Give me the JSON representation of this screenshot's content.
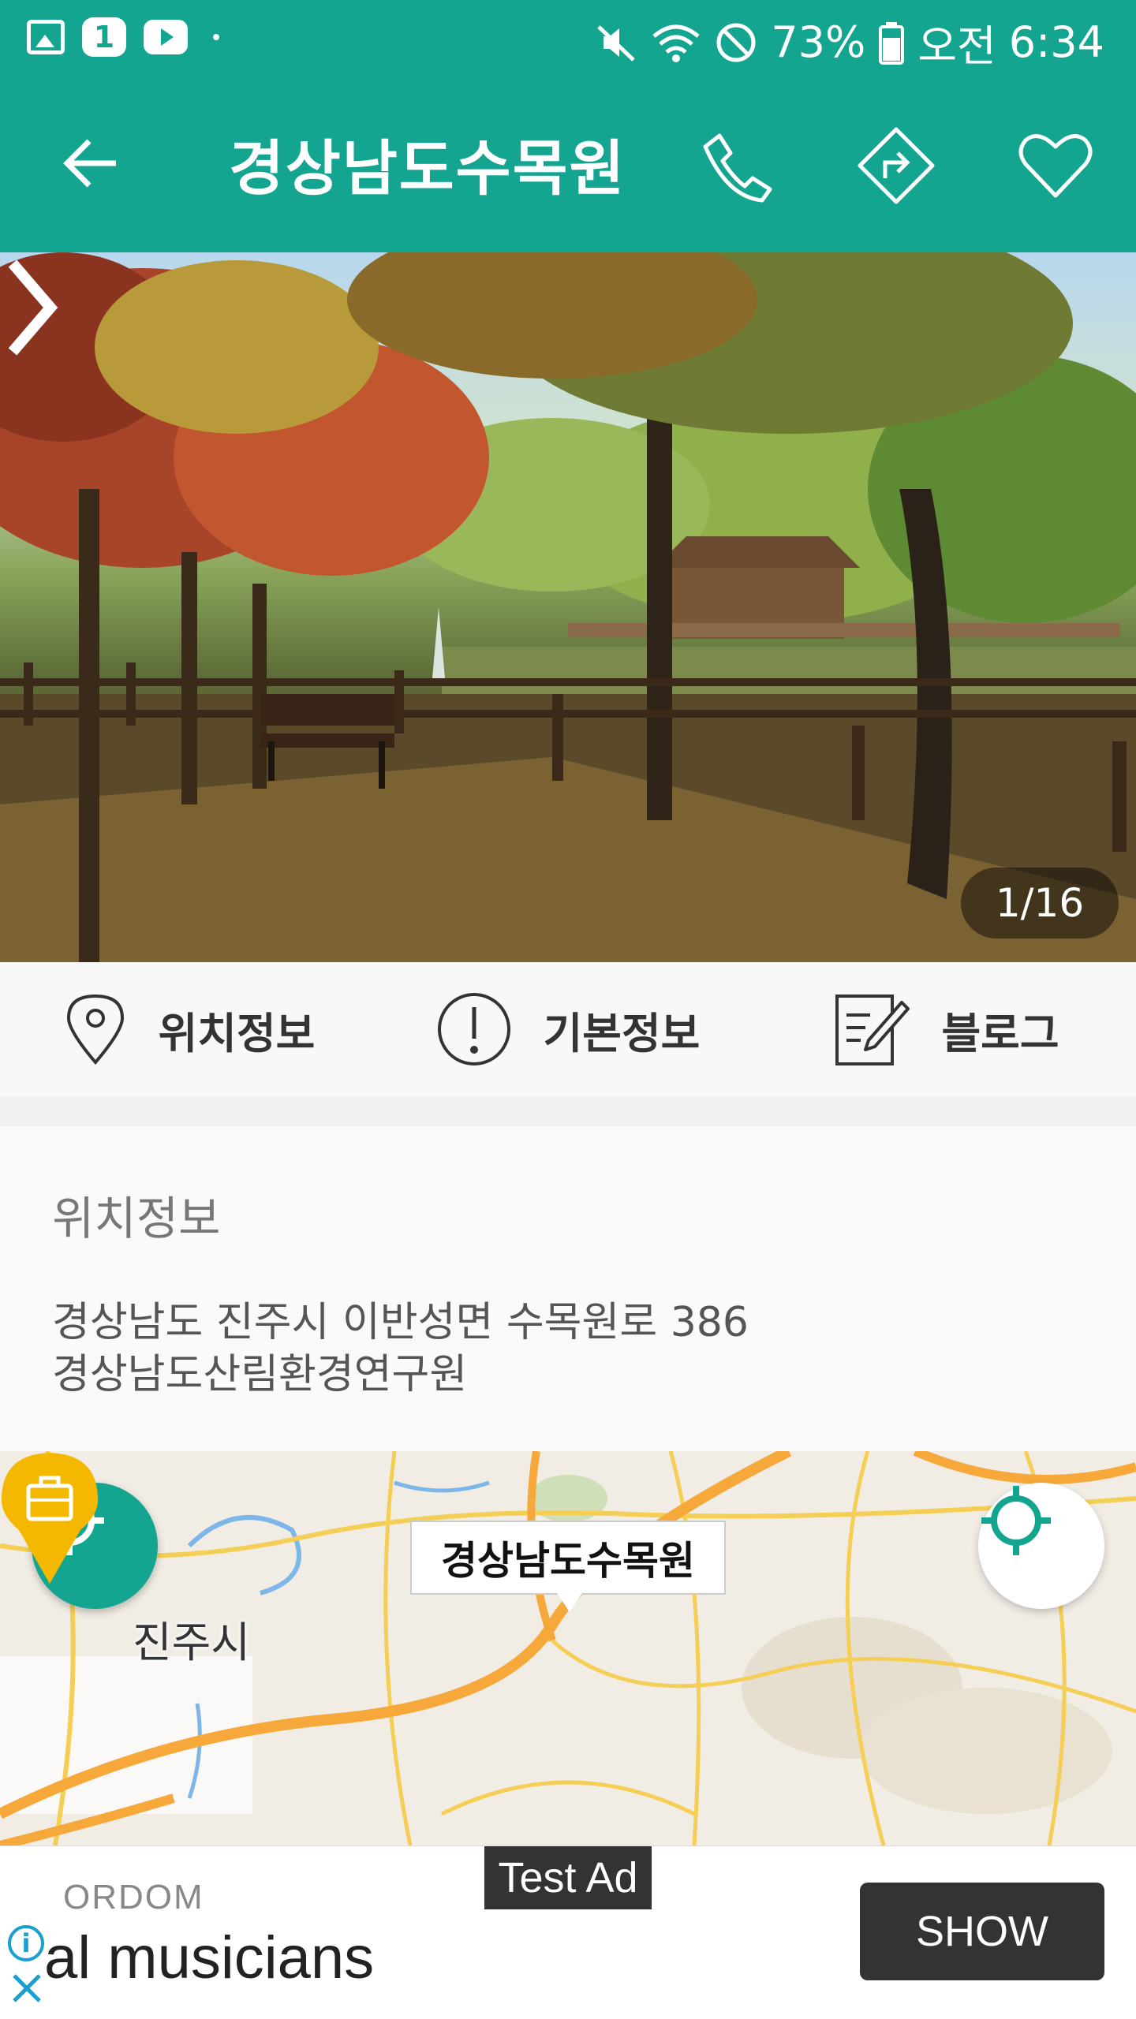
{
  "status_bar": {
    "battery": "73%",
    "ampm": "오전",
    "time": "6:34",
    "notification_badge": "1",
    "icons": [
      "image-icon",
      "one-badge-icon",
      "youtube-icon",
      "mute-icon",
      "wifi-icon",
      "block-icon",
      "battery-icon"
    ]
  },
  "app_bar": {
    "title": "경상남도수목원",
    "icons": [
      "back-arrow-icon",
      "phone-icon",
      "directions-icon",
      "heart-icon"
    ]
  },
  "photo": {
    "counter": "1/16"
  },
  "tabs": [
    {
      "label": "위치정보",
      "icon": "location-pin-icon"
    },
    {
      "label": "기본정보",
      "icon": "info-alert-icon"
    },
    {
      "label": "블로그",
      "icon": "blog-edit-icon"
    }
  ],
  "location": {
    "title": "위치정보",
    "address_line1": "경상남도 진주시 이반성면 수목원로 386",
    "address_line2": "경상남도산림환경연구원"
  },
  "map": {
    "callout": "경상남도수목원",
    "city_label": "진주시",
    "pin_icon": "briefcase-pin-icon"
  },
  "ad": {
    "test_label": "Test Ad",
    "brand": "ORDOM",
    "text": "al musicians",
    "button": "SHOW",
    "info": "i"
  },
  "colors": {
    "primary": "#14a591",
    "pin": "#f5b800",
    "road_major": "#f7a83a",
    "road_minor": "#f5cf55"
  }
}
